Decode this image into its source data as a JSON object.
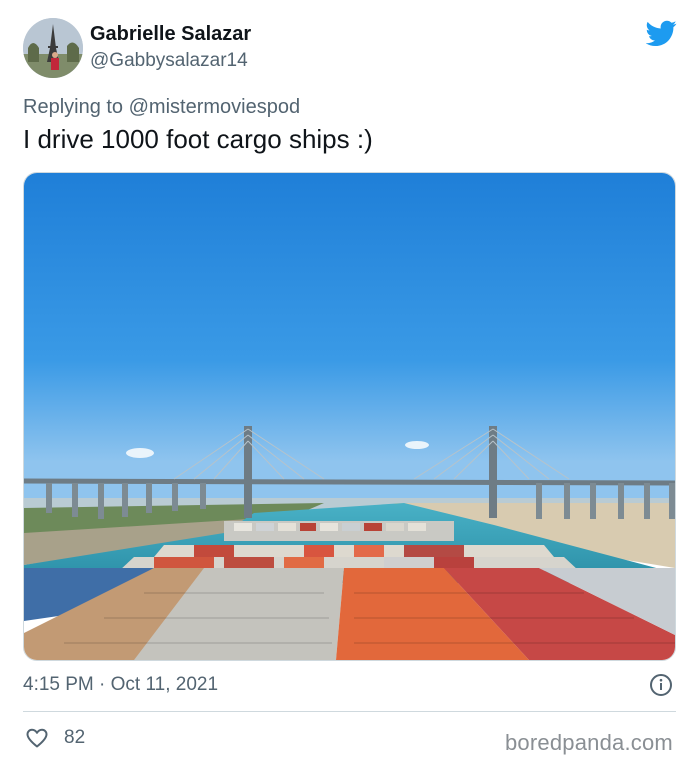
{
  "author": {
    "display_name": "Gabrielle Salazar",
    "handle": "@Gabbysalazar14",
    "avatar_icon": "avatar-photo"
  },
  "reply": {
    "label": "Replying to",
    "target": "@mistermoviespod"
  },
  "tweet": {
    "text": "I drive 1000 foot cargo ships :)"
  },
  "media": {
    "description_icon": "photo-cargo-ship-bridge"
  },
  "meta": {
    "timestamp": "4:15 PM · Oct 11, 2021"
  },
  "engagement": {
    "likes": "82"
  },
  "watermark": "boredpanda.com",
  "colors": {
    "twitter_blue": "#1d9bf0",
    "secondary_text": "#536471",
    "primary_text": "#0f1419",
    "divider": "#cfd9de"
  },
  "icons": {
    "brand": "twitter-bird-icon",
    "info": "info-icon",
    "like": "heart-icon"
  }
}
